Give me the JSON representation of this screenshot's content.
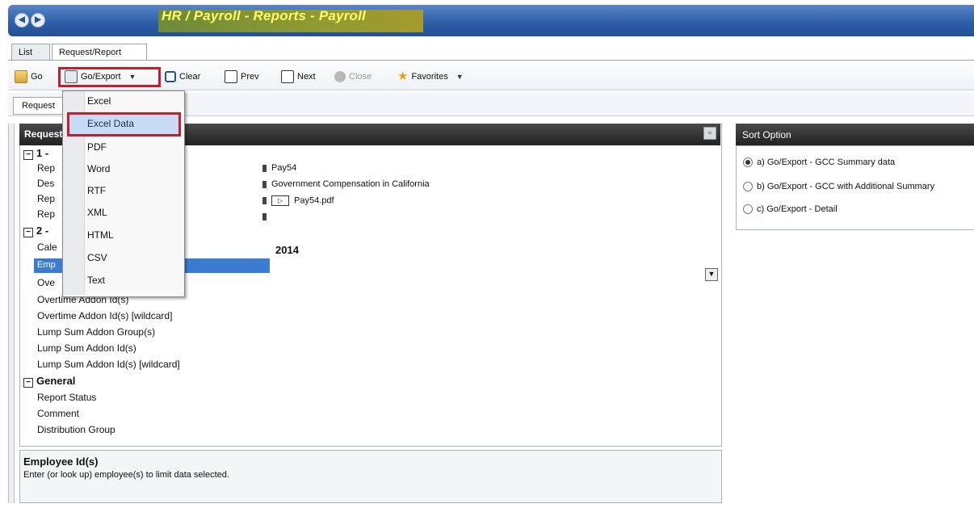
{
  "window": {
    "title": "HR / Payroll - Reports - Payroll"
  },
  "tabs": [
    {
      "label": "List"
    },
    {
      "label": "Request/Report"
    }
  ],
  "toolbar": {
    "go": "Go",
    "go_export": "Go/Export",
    "clear": "Clear",
    "prev": "Prev",
    "next": "Next",
    "close": "Close",
    "favorites": "Favorites"
  },
  "request_tab": "Request",
  "main": {
    "header": "Request",
    "groups": [
      {
        "label": "1 -",
        "items": [
          "Rep",
          "Des",
          "Rep",
          "Rep"
        ]
      },
      {
        "label": "2 -",
        "items": [
          "Cale",
          "Emp",
          "Ove",
          "Overtime Addon Id(s)",
          "Overtime Addon Id(s) [wildcard]",
          "Lump Sum Addon Group(s)",
          "Lump Sum Addon Id(s)",
          "Lump Sum Addon Id(s) [wildcard]"
        ]
      },
      {
        "label": "General",
        "items": [
          "Report Status",
          "Comment",
          "Distribution Group"
        ]
      }
    ],
    "values": {
      "v1": "Pay54",
      "v2": "Government Compensation in California",
      "v3_icon": "pdf-icon",
      "v3": "Pay54.pdf",
      "year": "2014"
    }
  },
  "description": {
    "title": "Employee Id(s)",
    "text": "Enter (or look up) employee(s) to limit data selected."
  },
  "sort": {
    "header": "Sort Option",
    "options": [
      {
        "label": "a) Go/Export - GCC Summary data",
        "selected": true
      },
      {
        "label": "b) Go/Export - GCC with Additional Summary",
        "selected": false
      },
      {
        "label": "c) Go/Export - Detail",
        "selected": false
      }
    ]
  },
  "export_menu": {
    "items": [
      "Excel",
      "Excel Data",
      "PDF",
      "Word",
      "RTF",
      "XML",
      "HTML",
      "CSV",
      "Text"
    ],
    "highlighted": "Excel Data"
  },
  "colors": {
    "highlight": "#c21f2e",
    "title_text": "#fffb6a",
    "selection": "#3b7bd0"
  }
}
